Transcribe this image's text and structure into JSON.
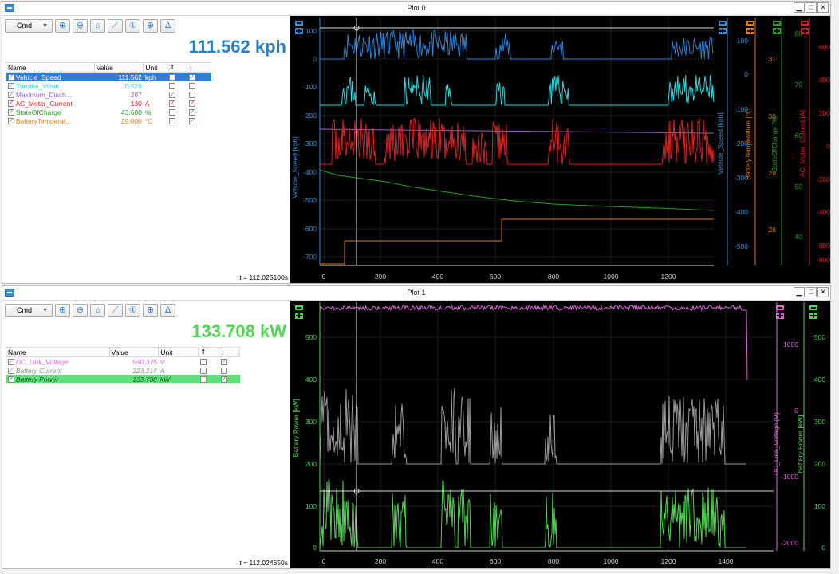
{
  "plot0": {
    "title": "Plot 0",
    "cmd_label": "Cmd",
    "big_value": "111.562 kph",
    "big_color": "#2a7ec4",
    "timestamp": "t = 112.025100s",
    "headers": {
      "name": "Name",
      "value": "Value",
      "unit": "Unit",
      "c1": "⇑",
      "c2": "↕"
    },
    "rows": [
      {
        "name": "Vehicle_Speed",
        "value": "111.562",
        "unit": "kph",
        "color": "#ffffff",
        "selected": true,
        "c1": false,
        "c2": true
      },
      {
        "name": "Throttle_Value",
        "value": "0.528",
        "unit": "",
        "color": "#2fd6de",
        "selected": false,
        "c1": false,
        "c2": false
      },
      {
        "name": "Maximum_Disch...",
        "value": "287",
        "unit": "",
        "color": "#a55dc8",
        "selected": false,
        "c1": true,
        "c2": false
      },
      {
        "name": "AC_Motor_Current",
        "value": "130",
        "unit": "A",
        "color": "#d42424",
        "selected": false,
        "c1": true,
        "c2": true
      },
      {
        "name": "StateOfCharge",
        "value": "43.600",
        "unit": "%",
        "color": "#2a9d2a",
        "selected": false,
        "c1": false,
        "c2": true
      },
      {
        "name": "BatteryTemperat...",
        "value": "29.000",
        "unit": "°C",
        "color": "#e07a1e",
        "selected": false,
        "c1": false,
        "c2": true
      }
    ],
    "left_axis": {
      "label": "Vehicle_Speed [kph]",
      "ticks": [
        "100",
        "0",
        "-100",
        "-200",
        "-300",
        "-400",
        "-500",
        "-600",
        "-700"
      ],
      "color": "#3a8fd8"
    },
    "right_axes": [
      {
        "label": "Vehicle_Speed [kph]",
        "ticks": [
          "100",
          "0",
          "-100",
          "-200",
          "-300",
          "-400",
          "-500"
        ],
        "color": "#3a8fd8"
      },
      {
        "label": "BatteryTemperature [°C]",
        "ticks": [
          "31",
          "30",
          "29",
          "28"
        ],
        "color": "#e07a1e"
      },
      {
        "label": "StateOfCharge [%]",
        "ticks": [
          "80",
          "70",
          "60",
          "50",
          "40"
        ],
        "color": "#2a9d2a"
      },
      {
        "label": "AC_Motor_Current [A]",
        "ticks": [
          "600",
          "400",
          "200",
          "0",
          "-200",
          "-400",
          "-600",
          "-800"
        ],
        "color": "#d42424"
      }
    ],
    "x_ticks": [
      "0",
      "200",
      "400",
      "600",
      "800",
      "1000",
      "1200"
    ]
  },
  "plot1": {
    "title": "Plot 1",
    "cmd_label": "Cmd",
    "big_value": "133.708 kW",
    "big_color": "#54d454",
    "timestamp": "t = 112.024650s",
    "headers": {
      "name": "Name",
      "value": "Value",
      "unit": "Unit",
      "c1": "⇑",
      "c2": "↕"
    },
    "rows": [
      {
        "name": "DC_Link_Voltage",
        "value": "590.375",
        "unit": "V",
        "color": "#d46ad4",
        "selected": false,
        "c1": false,
        "c2": true
      },
      {
        "name": "Battery Current",
        "value": "223.214",
        "unit": "A",
        "color": "#8a8a8a",
        "selected": false,
        "c1": false,
        "c2": false
      },
      {
        "name": "Battery Power",
        "value": "133.708",
        "unit": "kW",
        "color": "#1b5e1b",
        "selected": true,
        "c1": false,
        "c2": true
      }
    ],
    "left_axis": {
      "label": "Battery Power [kW]",
      "ticks": [
        "500",
        "400",
        "300",
        "200",
        "100",
        "0"
      ],
      "color": "#54d454"
    },
    "right_axes": [
      {
        "label": "DC_Link_Voltage [V]",
        "ticks": [
          "1000",
          "0",
          "-1000",
          "-2000"
        ],
        "color": "#d46ad4"
      },
      {
        "label": "Battery Power [kW]",
        "ticks": [
          "500",
          "400",
          "300",
          "200",
          "100",
          "0"
        ],
        "color": "#54d454"
      }
    ],
    "x_ticks": [
      "0",
      "200",
      "400",
      "600",
      "800",
      "1000",
      "1200",
      "1400"
    ]
  }
}
